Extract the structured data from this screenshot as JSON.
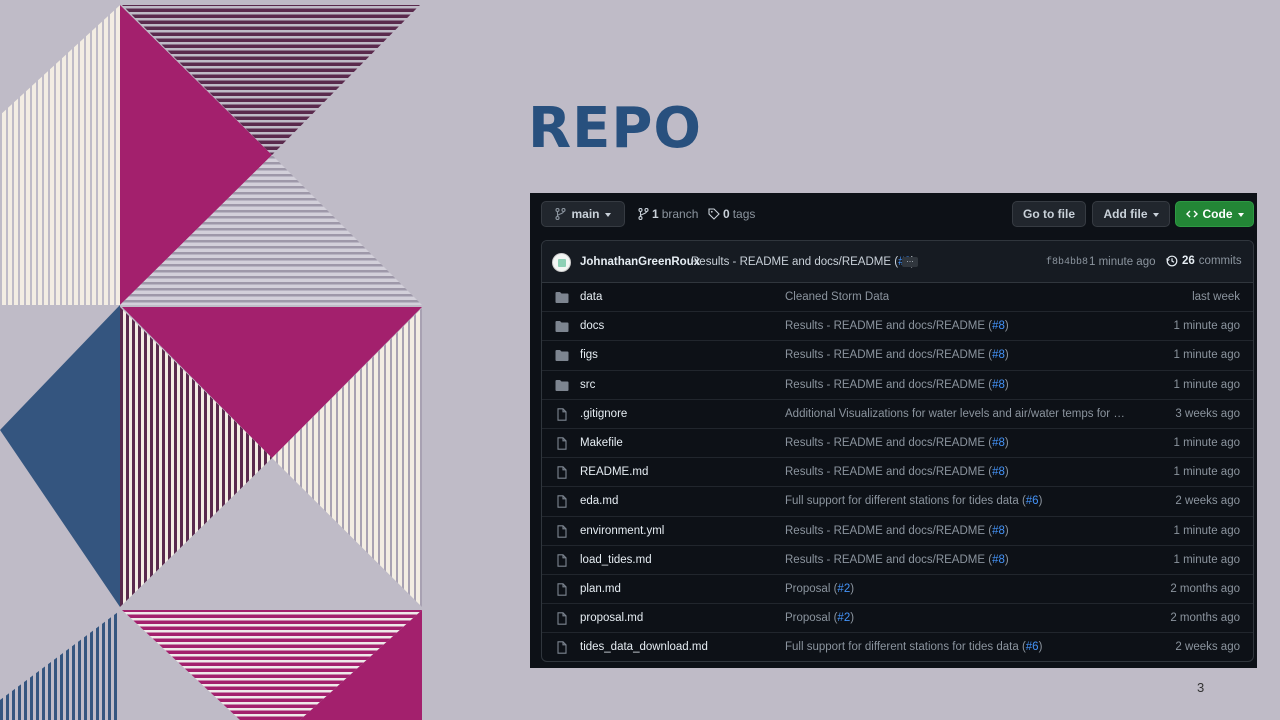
{
  "slide": {
    "title": "REPO",
    "page_number": "3"
  },
  "colors": {
    "magenta": "#a3206d",
    "navy": "#34557f",
    "plum": "#5a2a4d",
    "cream": "#f3ede3",
    "lavender": "#bfbbc7"
  },
  "toolbar": {
    "branch_label": "main",
    "branch_count": "1",
    "branch_word": "branch",
    "tag_count": "0",
    "tag_word": "tags",
    "goto_file": "Go to file",
    "add_file": "Add file",
    "code": "Code"
  },
  "commit": {
    "author": "JohnathanGreenRoux",
    "message": "Results - README and docs/README (",
    "pr": "#8",
    "close": ")",
    "ellipsis": "…",
    "sha": "f8b4bb8",
    "time": "1 minute ago",
    "count": "26",
    "count_word": "commits"
  },
  "files": [
    {
      "type": "folder",
      "name": "data",
      "msg": "Cleaned Storm Data",
      "pr": "",
      "age": "last week"
    },
    {
      "type": "folder",
      "name": "docs",
      "msg": "Results - README and docs/README (",
      "pr": "#8",
      "age": "1 minute ago"
    },
    {
      "type": "folder",
      "name": "figs",
      "msg": "Results - README and docs/README (",
      "pr": "#8",
      "age": "1 minute ago"
    },
    {
      "type": "folder",
      "name": "src",
      "msg": "Results - README and docs/README (",
      "pr": "#8",
      "age": "1 minute ago"
    },
    {
      "type": "file",
      "name": ".gitignore",
      "msg": "Additional Visualizations for water levels and air/water temps for Po…",
      "pr": "",
      "age": "3 weeks ago"
    },
    {
      "type": "file",
      "name": "Makefile",
      "msg": "Results - README and docs/README (",
      "pr": "#8",
      "age": "1 minute ago"
    },
    {
      "type": "file",
      "name": "README.md",
      "msg": "Results - README and docs/README (",
      "pr": "#8",
      "age": "1 minute ago"
    },
    {
      "type": "file",
      "name": "eda.md",
      "msg": "Full support for different stations for tides data (",
      "pr": "#6",
      "age": "2 weeks ago"
    },
    {
      "type": "file",
      "name": "environment.yml",
      "msg": "Results - README and docs/README (",
      "pr": "#8",
      "age": "1 minute ago"
    },
    {
      "type": "file",
      "name": "load_tides.md",
      "msg": "Results - README and docs/README (",
      "pr": "#8",
      "age": "1 minute ago"
    },
    {
      "type": "file",
      "name": "plan.md",
      "msg": "Proposal (",
      "pr": "#2",
      "age": "2 months ago"
    },
    {
      "type": "file",
      "name": "proposal.md",
      "msg": "Proposal (",
      "pr": "#2",
      "age": "2 months ago"
    },
    {
      "type": "file",
      "name": "tides_data_download.md",
      "msg": "Full support for different stations for tides data (",
      "pr": "#6",
      "age": "2 weeks ago"
    }
  ]
}
